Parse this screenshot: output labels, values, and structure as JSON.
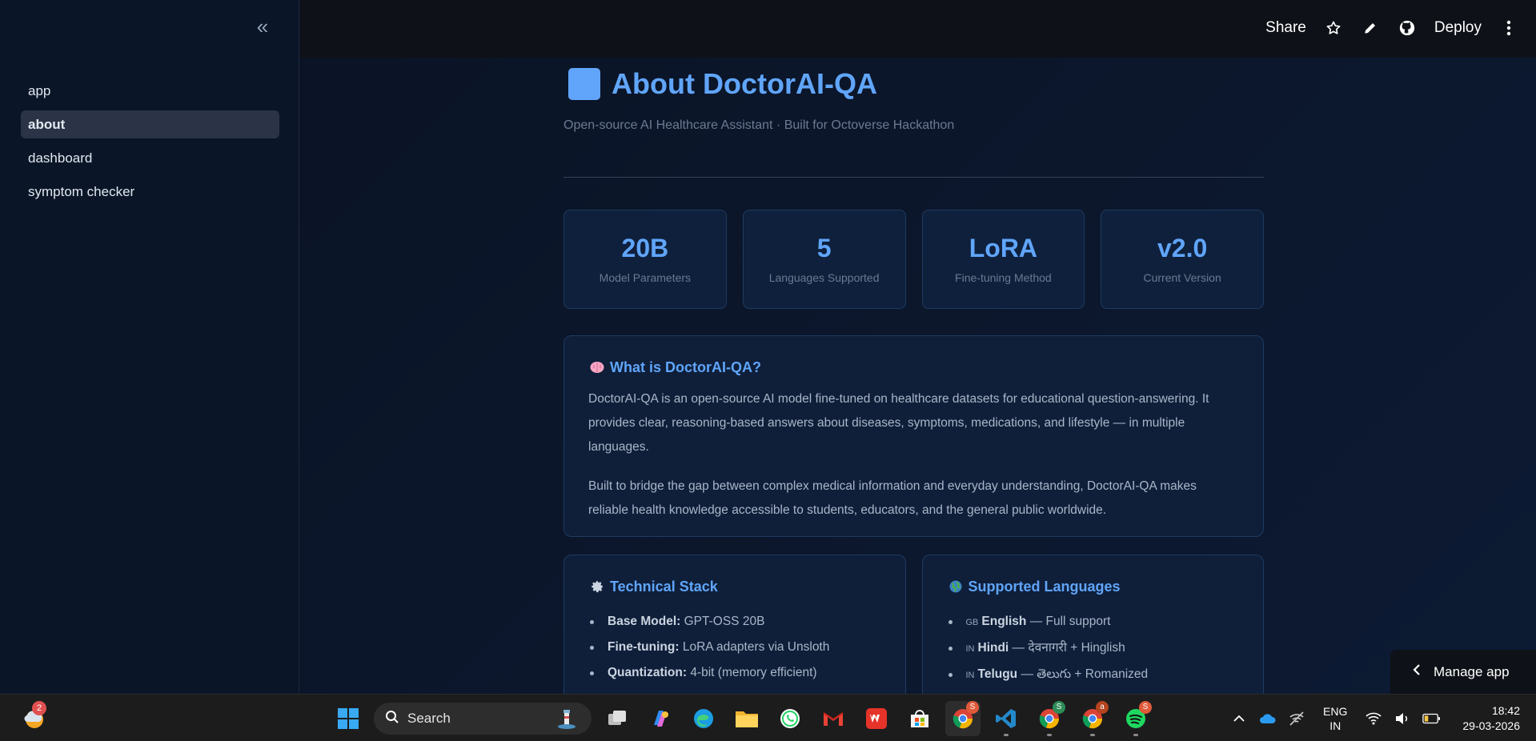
{
  "sidebar": {
    "items": [
      {
        "label": "app",
        "active": false
      },
      {
        "label": "about",
        "active": true
      },
      {
        "label": "dashboard",
        "active": false
      },
      {
        "label": "symptom checker",
        "active": false
      }
    ]
  },
  "header": {
    "share": "Share",
    "deploy": "Deploy"
  },
  "page": {
    "title": "About DoctorAI-QA",
    "subtitle": "Open-source AI Healthcare Assistant · Built for Octoverse Hackathon",
    "accent_color": "#60a5fa"
  },
  "stats": [
    {
      "value": "20B",
      "label": "Model Parameters"
    },
    {
      "value": "5",
      "label": "Languages Supported"
    },
    {
      "value": "LoRA",
      "label": "Fine-tuning Method"
    },
    {
      "value": "v2.0",
      "label": "Current Version"
    }
  ],
  "about": {
    "heading": "What is DoctorAI-QA?",
    "icon": "brain-icon",
    "paragraph1": "DoctorAI-QA is an open-source AI model fine-tuned on healthcare datasets for educational question-answering. It provides clear, reasoning-based answers about diseases, symptoms, medications, and lifestyle — in multiple languages.",
    "paragraph2": "Built to bridge the gap between complex medical information and everyday understanding, DoctorAI-QA makes reliable health knowledge accessible to students, educators, and the general public worldwide."
  },
  "tech": {
    "heading": "Technical Stack",
    "icon": "gear-icon",
    "items": [
      {
        "key": "Base Model:",
        "value": " GPT-OSS 20B"
      },
      {
        "key": "Fine-tuning:",
        "value": " LoRA adapters via Unsloth"
      },
      {
        "key": "Quantization:",
        "value": " 4-bit (memory efficient)"
      }
    ]
  },
  "languages": {
    "heading": "Supported Languages",
    "icon": "globe-icon",
    "items": [
      {
        "code": "GB",
        "name": "English",
        "desc": " — Full support"
      },
      {
        "code": "IN",
        "name": "Hindi",
        "desc": " — देवनागरी + Hinglish"
      },
      {
        "code": "IN",
        "name": "Telugu",
        "desc": " — తెలుగు + Romanized"
      }
    ]
  },
  "manage_app": "Manage app",
  "taskbar": {
    "weather_badge": "2",
    "search_label": "Search",
    "apps": [
      {
        "name": "task-view",
        "icon": "task-view-icon"
      },
      {
        "name": "copilot",
        "icon": "copilot-icon"
      },
      {
        "name": "edge",
        "icon": "edge-icon"
      },
      {
        "name": "file-explorer",
        "icon": "folder-icon"
      },
      {
        "name": "whatsapp",
        "icon": "whatsapp-icon"
      },
      {
        "name": "gmail",
        "icon": "gmail-icon"
      },
      {
        "name": "wps-office",
        "icon": "wps-icon"
      },
      {
        "name": "microsoft-store",
        "icon": "store-icon"
      },
      {
        "name": "chrome-s",
        "icon": "chrome-icon",
        "badge": "S",
        "badge_color": "#e05a3a"
      },
      {
        "name": "vscode",
        "icon": "vscode-icon"
      },
      {
        "name": "chrome-s-green",
        "icon": "chrome-icon",
        "badge": "S",
        "badge_color": "#2e8b57"
      },
      {
        "name": "chrome-a",
        "icon": "chrome-icon",
        "badge": "a",
        "badge_color": "#b5441f"
      },
      {
        "name": "spotify",
        "icon": "spotify-icon",
        "badge": "S",
        "badge_color": "#e05a3a"
      }
    ],
    "lang_line1": "ENG",
    "lang_line2": "IN",
    "time": "18:42",
    "date": "29-03-2026"
  }
}
